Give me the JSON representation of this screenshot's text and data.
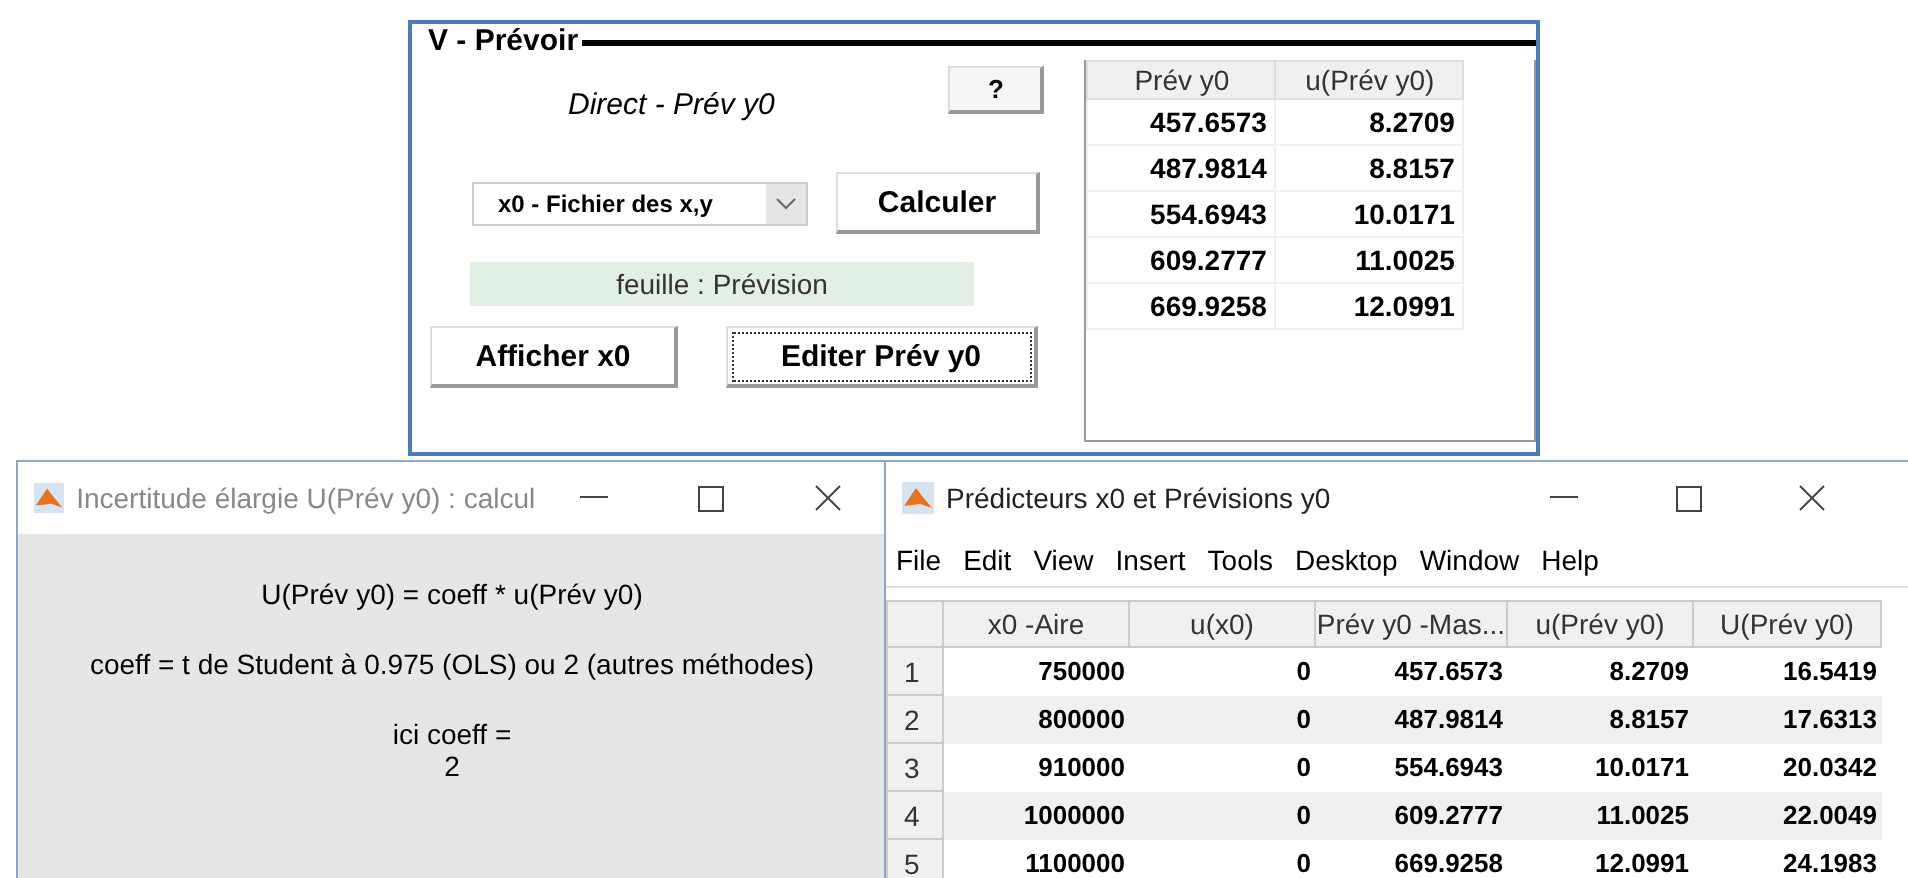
{
  "panel": {
    "title": "V - Prévoir",
    "help_button": "?",
    "mode_label": "Direct - Prév y0",
    "source_select": "x0 - Fichier des x,y",
    "calculate_button": "Calculer",
    "sheet_label": "feuille : Prévision",
    "buttons": [
      {
        "label": "Afficher x0",
        "focused": false
      },
      {
        "label": "Editer Prév y0",
        "focused": true
      }
    ],
    "table": {
      "columns": [
        "Prév y0",
        "u(Prév y0)"
      ],
      "rows": [
        [
          "457.6573",
          "8.2709"
        ],
        [
          "487.9814",
          "8.8157"
        ],
        [
          "554.6943",
          "10.0171"
        ],
        [
          "609.2777",
          "11.0025"
        ],
        [
          "669.9258",
          "12.0991"
        ]
      ]
    }
  },
  "uncertainty_window": {
    "title": "Incertitude élargie U(Prév y0) : calcul",
    "paragraphs": [
      [
        "U(Prév y0) = coeff * u(Prév y0)"
      ],
      [
        "coeff = t de Student à 0.975 (OLS) ou 2 (autres méthodes)"
      ],
      [
        "ici coeff =",
        "2"
      ]
    ]
  },
  "results_window": {
    "title": "Prédicteurs x0 et Prévisions y0",
    "menu": [
      "File",
      "Edit",
      "View",
      "Insert",
      "Tools",
      "Desktop",
      "Window",
      "Help"
    ],
    "table": {
      "columns": [
        "x0 -Aire",
        "u(x0)",
        "Prév y0 -Mas...",
        "u(Prév y0)",
        "U(Prév y0)"
      ],
      "rows": [
        {
          "index": "1",
          "cells": [
            "750000",
            "0",
            "457.6573",
            "8.2709",
            "16.5419"
          ]
        },
        {
          "index": "2",
          "cells": [
            "800000",
            "0",
            "487.9814",
            "8.8157",
            "17.6313"
          ]
        },
        {
          "index": "3",
          "cells": [
            "910000",
            "0",
            "554.6943",
            "10.0171",
            "20.0342"
          ]
        },
        {
          "index": "4",
          "cells": [
            "1000000",
            "0",
            "609.2777",
            "11.0025",
            "22.0049"
          ]
        },
        {
          "index": "5",
          "cells": [
            "1100000",
            "0",
            "669.9258",
            "12.0991",
            "24.1983"
          ]
        }
      ]
    }
  }
}
